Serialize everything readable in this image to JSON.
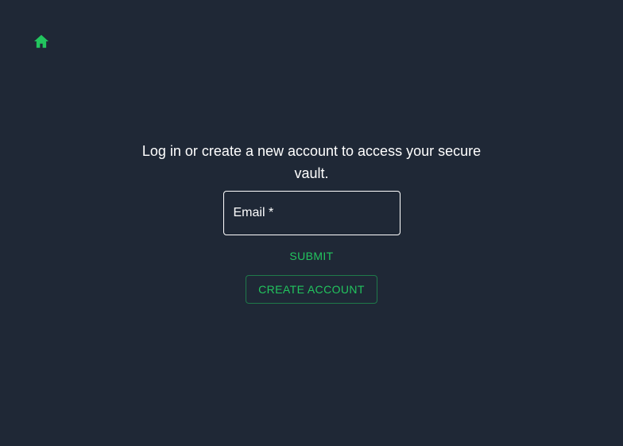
{
  "nav": {
    "home_icon": "home-icon"
  },
  "colors": {
    "background": "#1f2836",
    "accent": "#22c55e",
    "text": "#ffffff"
  },
  "login": {
    "intro_text": "Log in or create a new account to access your secure vault.",
    "email_placeholder": "Email *",
    "email_value": "",
    "submit_label": "SUBMIT",
    "create_account_label": "CREATE ACCOUNT"
  }
}
